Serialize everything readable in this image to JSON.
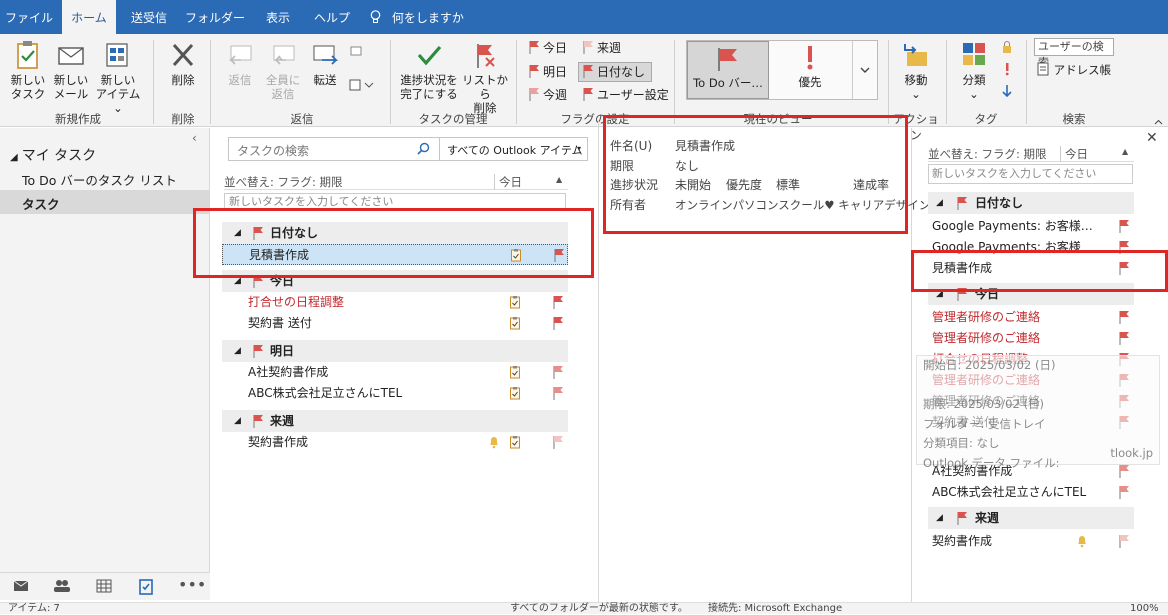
{
  "tabs": [
    "ファイル",
    "ホーム",
    "送受信",
    "フォルダー",
    "表示",
    "ヘルプ"
  ],
  "tell_me": "何をしますか",
  "ribbon": {
    "new_task": "新しい\nタスク",
    "new_mail": "新しい\nメール",
    "new_items": "新しい\nアイテム ⌄",
    "group_new": "新規作成",
    "delete": "削除",
    "group_delete": "削除",
    "reply": "返信",
    "reply_all": "全員に\n返信",
    "forward": "転送",
    "group_respond": "返信",
    "mark_complete": "進捗状況を\n完了にする",
    "remove_list": "リストから\n削除",
    "group_manage": "タスクの管理",
    "flag_today": "今日",
    "flag_tomorrow": "明日",
    "flag_thisweek": "今週",
    "flag_nextweek": "来週",
    "flag_nodate": "日付なし",
    "flag_custom": "ユーザー設定",
    "group_flags": "フラグの設定",
    "view_todo": "To Do バー…",
    "view_priority": "優先",
    "group_view": "現在のビュー",
    "move": "移動\n⌄",
    "group_actions": "アクション",
    "categorize": "分類\n⌄",
    "group_tags": "タグ",
    "search_people": "ユーザーの検索",
    "address_book": "アドレス帳",
    "group_find": "検索"
  },
  "nav": {
    "header": "マイ タスク",
    "items": [
      "To Do バーのタスク リスト",
      "タスク"
    ]
  },
  "list": {
    "search_placeholder": "タスクの検索",
    "scope": "すべての Outlook アイテム",
    "sort": "並べ替え: フラグ: 期限",
    "sort_right": "今日",
    "new_task_placeholder": "新しいタスクを入力してください",
    "sections": [
      {
        "title": "日付なし",
        "items": [
          "見積書作成"
        ]
      },
      {
        "title": "今日",
        "items": [
          "打合せの日程調整",
          "契約書 送付"
        ]
      },
      {
        "title": "明日",
        "items": [
          "A社契約書作成",
          "ABC株式会社足立さんにTEL"
        ]
      },
      {
        "title": "来週",
        "items": [
          "契約書作成"
        ]
      }
    ]
  },
  "preview": {
    "subject_label": "件名(U)",
    "subject": "見積書作成",
    "due_label": "期限",
    "due": "なし",
    "status_label": "進捗状況",
    "status": "未開始",
    "priority_label": "優先度",
    "priority": "標準",
    "percent_label": "達成率",
    "owner_label": "所有者",
    "owner": "オンラインパソコンスクール♥ キャリアデザイン"
  },
  "todobar": {
    "sort": "並べ替え: フラグ: 期限",
    "sort_right": "今日",
    "new_task_placeholder": "新しいタスクを入力してください",
    "sec_nodate": "日付なし",
    "nodate_items": [
      "Google Payments: お客様…",
      "Google Payments: お客様",
      "見積書作成"
    ],
    "sec_today": "今日",
    "today_items": [
      "管理者研修のご連絡",
      "管理者研修のご連絡",
      "打合せの日程調整",
      "管理者研修のご連絡",
      "管理者研修のご連絡",
      "契約書 送付"
    ],
    "tooltip": [
      "開始日: 2025/03/02 (日)",
      "期限: 2025/03/02 (日)",
      "フォルダー: 受信トレイ",
      "分類項目: なし",
      "Outlook データ ファイル:"
    ],
    "tooltip_tail": "tlook.jp",
    "rest_items": [
      "A社契約書作成",
      "ABC株式会社足立さんにTEL"
    ],
    "sec_nextweek": "来週",
    "nextweek_items": [
      "契約書作成"
    ]
  },
  "status": {
    "left": "アイテム: 7",
    "mid": "すべてのフォルダーが最新の状態です。",
    "right": "接続先: Microsoft Exchange",
    "zoom": "100%"
  },
  "colors": {
    "accent": "#2b6ab5",
    "flag": "#d9534f",
    "highlight": "#e02525",
    "red_text": "#c0282e"
  }
}
